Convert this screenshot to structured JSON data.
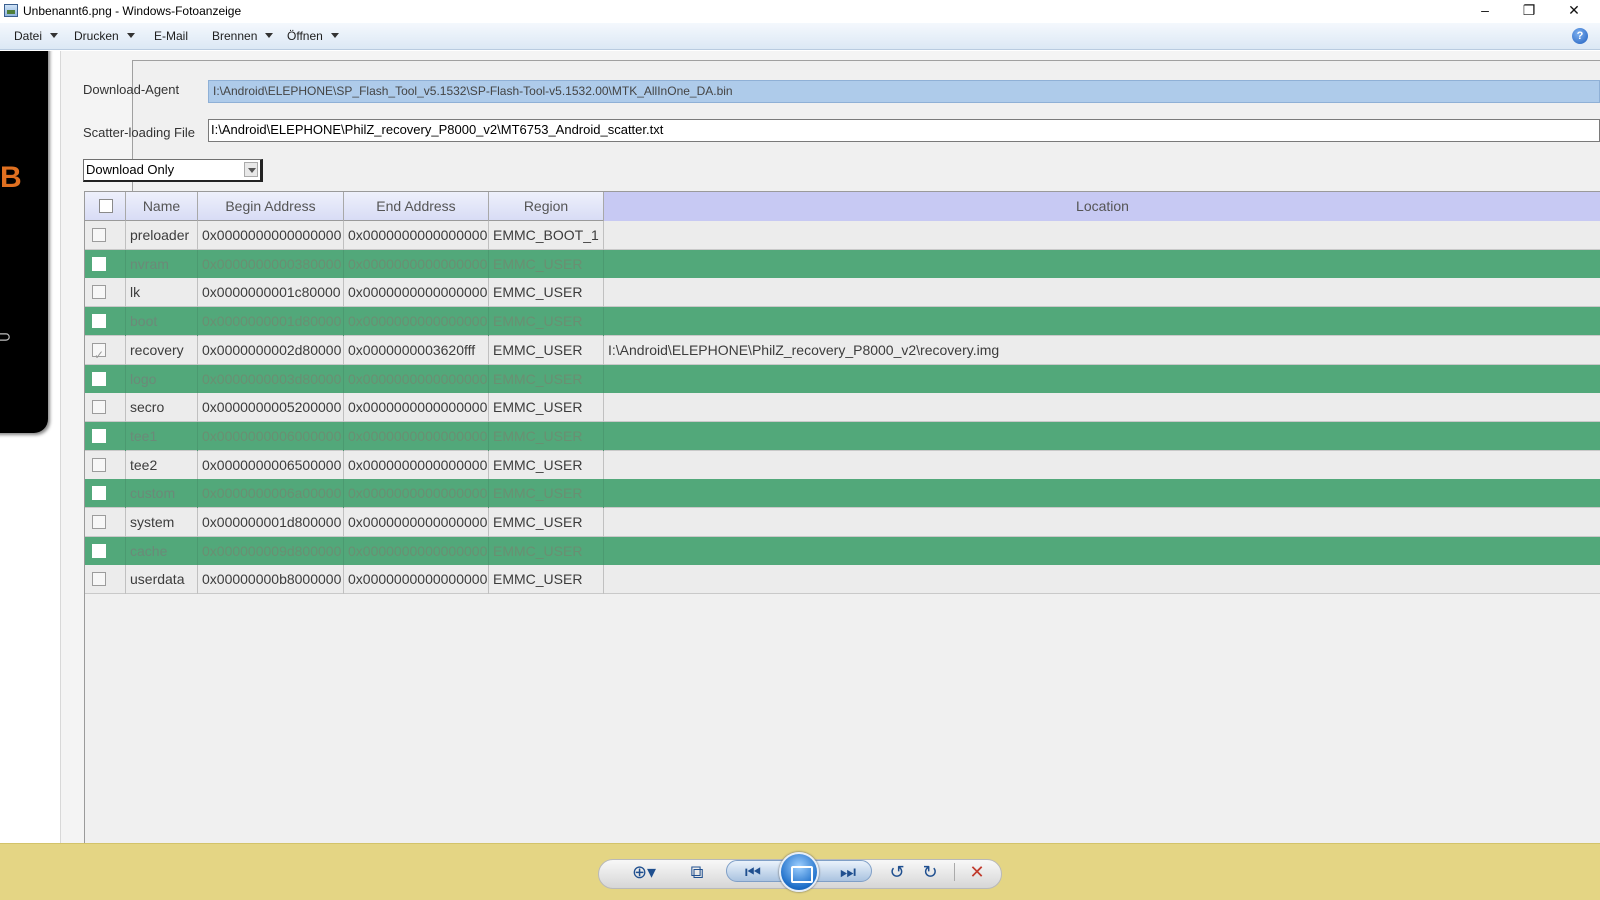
{
  "window": {
    "title": "Unbenannt6.png - Windows-Fotoanzeige",
    "minimize": "–",
    "restore": "❐",
    "close": "✕"
  },
  "menu": {
    "items": [
      "Datei",
      "Drucken",
      "E-Mail",
      "Brennen",
      "Öffnen"
    ],
    "help": "?"
  },
  "tool": {
    "da_label": "Download-Agent",
    "da_value": "I:\\Android\\ELEPHONE\\SP_Flash_Tool_v5.1532\\SP-Flash-Tool-v5.1532.00\\MTK_AllInOne_DA.bin",
    "scatter_label": "Scatter-loading File",
    "scatter_value": "I:\\Android\\ELEPHONE\\PhilZ_recovery_P8000_v2\\MT6753_Android_scatter.txt",
    "mode_selected": "Download Only"
  },
  "table": {
    "columns": [
      "Name",
      "Begin Address",
      "End Address",
      "Region",
      "Location"
    ],
    "rows": [
      {
        "name": "preloader",
        "begin": "0x0000000000000000",
        "end": "0x0000000000000000",
        "region": "EMMC_BOOT_1",
        "location": "",
        "checked": false
      },
      {
        "name": "nvram",
        "begin": "0x0000000000380000",
        "end": "0x0000000000000000",
        "region": "EMMC_USER",
        "location": "",
        "checked": false
      },
      {
        "name": "lk",
        "begin": "0x0000000001c80000",
        "end": "0x0000000000000000",
        "region": "EMMC_USER",
        "location": "",
        "checked": false
      },
      {
        "name": "boot",
        "begin": "0x0000000001d80000",
        "end": "0x0000000000000000",
        "region": "EMMC_USER",
        "location": "",
        "checked": false
      },
      {
        "name": "recovery",
        "begin": "0x0000000002d80000",
        "end": "0x0000000003620fff",
        "region": "EMMC_USER",
        "location": "I:\\Android\\ELEPHONE\\PhilZ_recovery_P8000_v2\\recovery.img",
        "checked": true
      },
      {
        "name": "logo",
        "begin": "0x0000000003d80000",
        "end": "0x0000000000000000",
        "region": "EMMC_USER",
        "location": "",
        "checked": false
      },
      {
        "name": "secro",
        "begin": "0x0000000005200000",
        "end": "0x0000000000000000",
        "region": "EMMC_USER",
        "location": "",
        "checked": false
      },
      {
        "name": "tee1",
        "begin": "0x0000000006000000",
        "end": "0x0000000000000000",
        "region": "EMMC_USER",
        "location": "",
        "checked": false
      },
      {
        "name": "tee2",
        "begin": "0x0000000006500000",
        "end": "0x0000000000000000",
        "region": "EMMC_USER",
        "location": "",
        "checked": false
      },
      {
        "name": "custom",
        "begin": "0x0000000006a00000",
        "end": "0x0000000000000000",
        "region": "EMMC_USER",
        "location": "",
        "checked": false
      },
      {
        "name": "system",
        "begin": "0x000000001d800000",
        "end": "0x0000000000000000",
        "region": "EMMC_USER",
        "location": "",
        "checked": false
      },
      {
        "name": "cache",
        "begin": "0x000000009d800000",
        "end": "0x0000000000000000",
        "region": "EMMC_USER",
        "location": "",
        "checked": false
      },
      {
        "name": "userdata",
        "begin": "0x00000000b8000000",
        "end": "0x0000000000000000",
        "region": "EMMC_USER",
        "location": "",
        "checked": false
      }
    ]
  },
  "controls": {
    "zoom": "⊕▾",
    "fit": "⧉",
    "previous": "⏮",
    "next": "⏭",
    "rotate_left": "↺",
    "rotate_right": "↻",
    "delete": "✕"
  },
  "colors": {
    "control_bar": "#e4d584",
    "highlight_row": "#52a87a",
    "location_header": "#c7c9f3"
  }
}
